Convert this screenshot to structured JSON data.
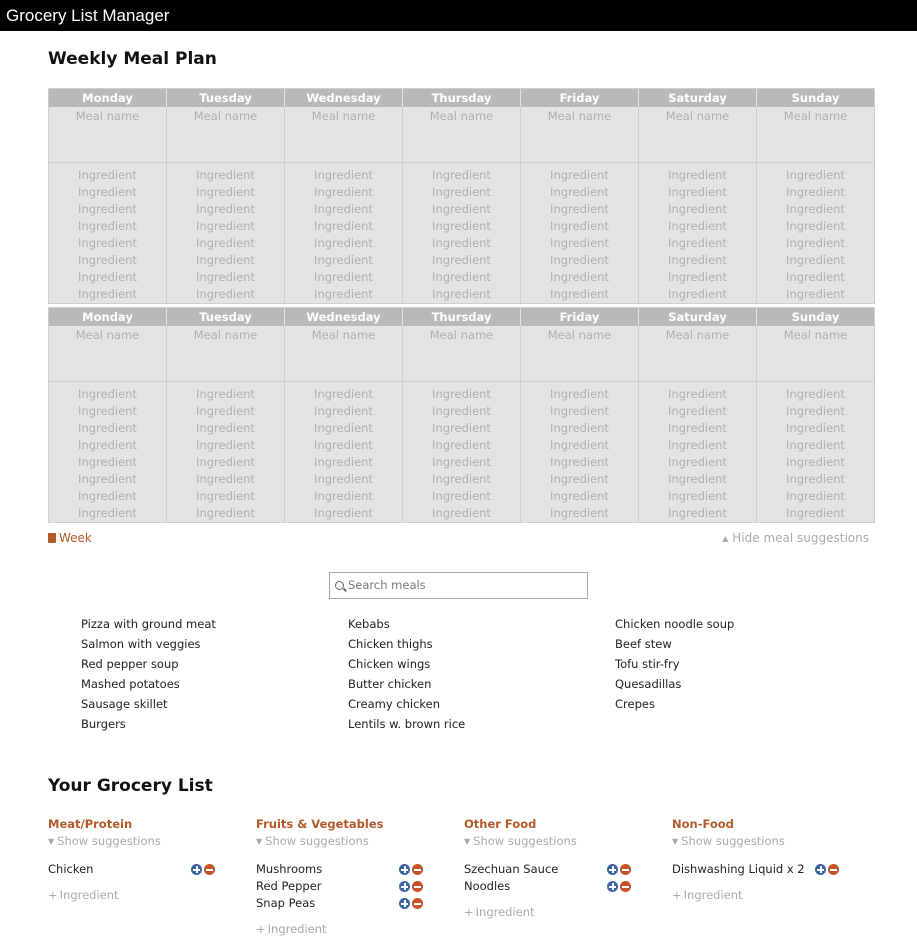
{
  "app": {
    "title": "Grocery List Manager"
  },
  "meal_plan": {
    "heading": "Weekly Meal Plan",
    "days": [
      "Monday",
      "Tuesday",
      "Wednesday",
      "Thursday",
      "Friday",
      "Saturday",
      "Sunday"
    ],
    "meal_placeholder": "Meal name",
    "ingredient_placeholder": "Ingredient",
    "week_label": "Week",
    "hide_suggestions_label": "Hide meal suggestions"
  },
  "search": {
    "placeholder": "Search meals"
  },
  "suggestions": {
    "col1": [
      "Pizza with ground meat",
      "Salmon with veggies",
      "Red pepper soup",
      "Mashed potatoes",
      "Sausage skillet",
      "Burgers"
    ],
    "col2": [
      "Kebabs",
      "Chicken thighs",
      "Chicken wings",
      "Butter chicken",
      "Creamy chicken",
      "Lentils w. brown rice"
    ],
    "col3": [
      "Chicken noodle soup",
      "Beef stew",
      "Tofu stir-fry",
      "Quesadillas",
      "Crepes"
    ]
  },
  "grocery": {
    "heading": "Your Grocery List",
    "show_suggestions_label": "Show suggestions",
    "add_ingredient_label": "Ingredient",
    "categories": [
      {
        "title": "Meat/Protein",
        "items": [
          "Chicken"
        ]
      },
      {
        "title": "Fruits & Vegetables",
        "items": [
          "Mushrooms",
          "Red Pepper",
          "Snap Peas"
        ]
      },
      {
        "title": "Other Food",
        "items": [
          "Szechuan Sauce",
          "Noodles"
        ]
      },
      {
        "title": "Non-Food",
        "items": [
          "Dishwashing Liquid x 2"
        ]
      }
    ]
  },
  "colors": {
    "accent": "#b3592a",
    "header_bg": "#b9b9b9",
    "plus": "#3c64a8",
    "minus": "#c4532a"
  }
}
